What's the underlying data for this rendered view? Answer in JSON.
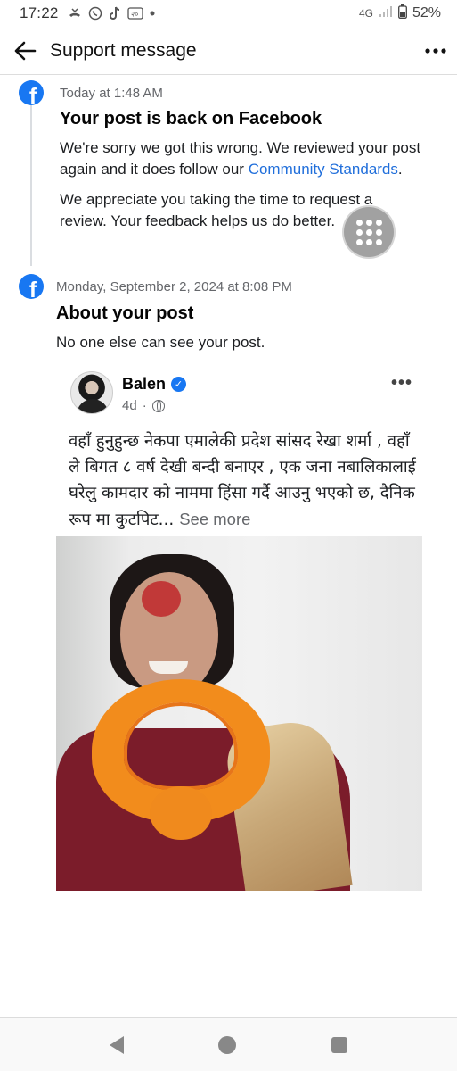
{
  "status_bar": {
    "time": "17:22",
    "network": "4G",
    "battery": "52%"
  },
  "header": {
    "title": "Support message"
  },
  "messages": [
    {
      "time": "Today at 1:48 AM",
      "title": "Your post is back on Facebook",
      "para1_prefix": "We're sorry we got this wrong. We reviewed your post again and it does follow our ",
      "para1_link": "Community Standards",
      "para1_suffix": ".",
      "para2": "We appreciate you taking the time to request a review. Your feedback helps us do better."
    },
    {
      "time": "Monday, September 2, 2024 at 8:08 PM",
      "title": "About your post",
      "body": "No one else can see your post."
    }
  ],
  "post": {
    "author": "Balen",
    "age": "4d",
    "text": "वहाँ  हुनुहुन्छ नेकपा एमालेकी प्रदेश सांसद रेखा शर्मा , वहाँ ले बिगत ८ वर्ष देखी बन्दी बनाएर , एक जना नबालिकालाई घरेलु कामदार को नाममा हिंसा गर्दै आउनु भएको छ, दैनिक रूप मा कुटपिट...",
    "see_more": "See more"
  },
  "colors": {
    "facebook_blue": "#1877f2",
    "link_blue": "#216fdb"
  }
}
